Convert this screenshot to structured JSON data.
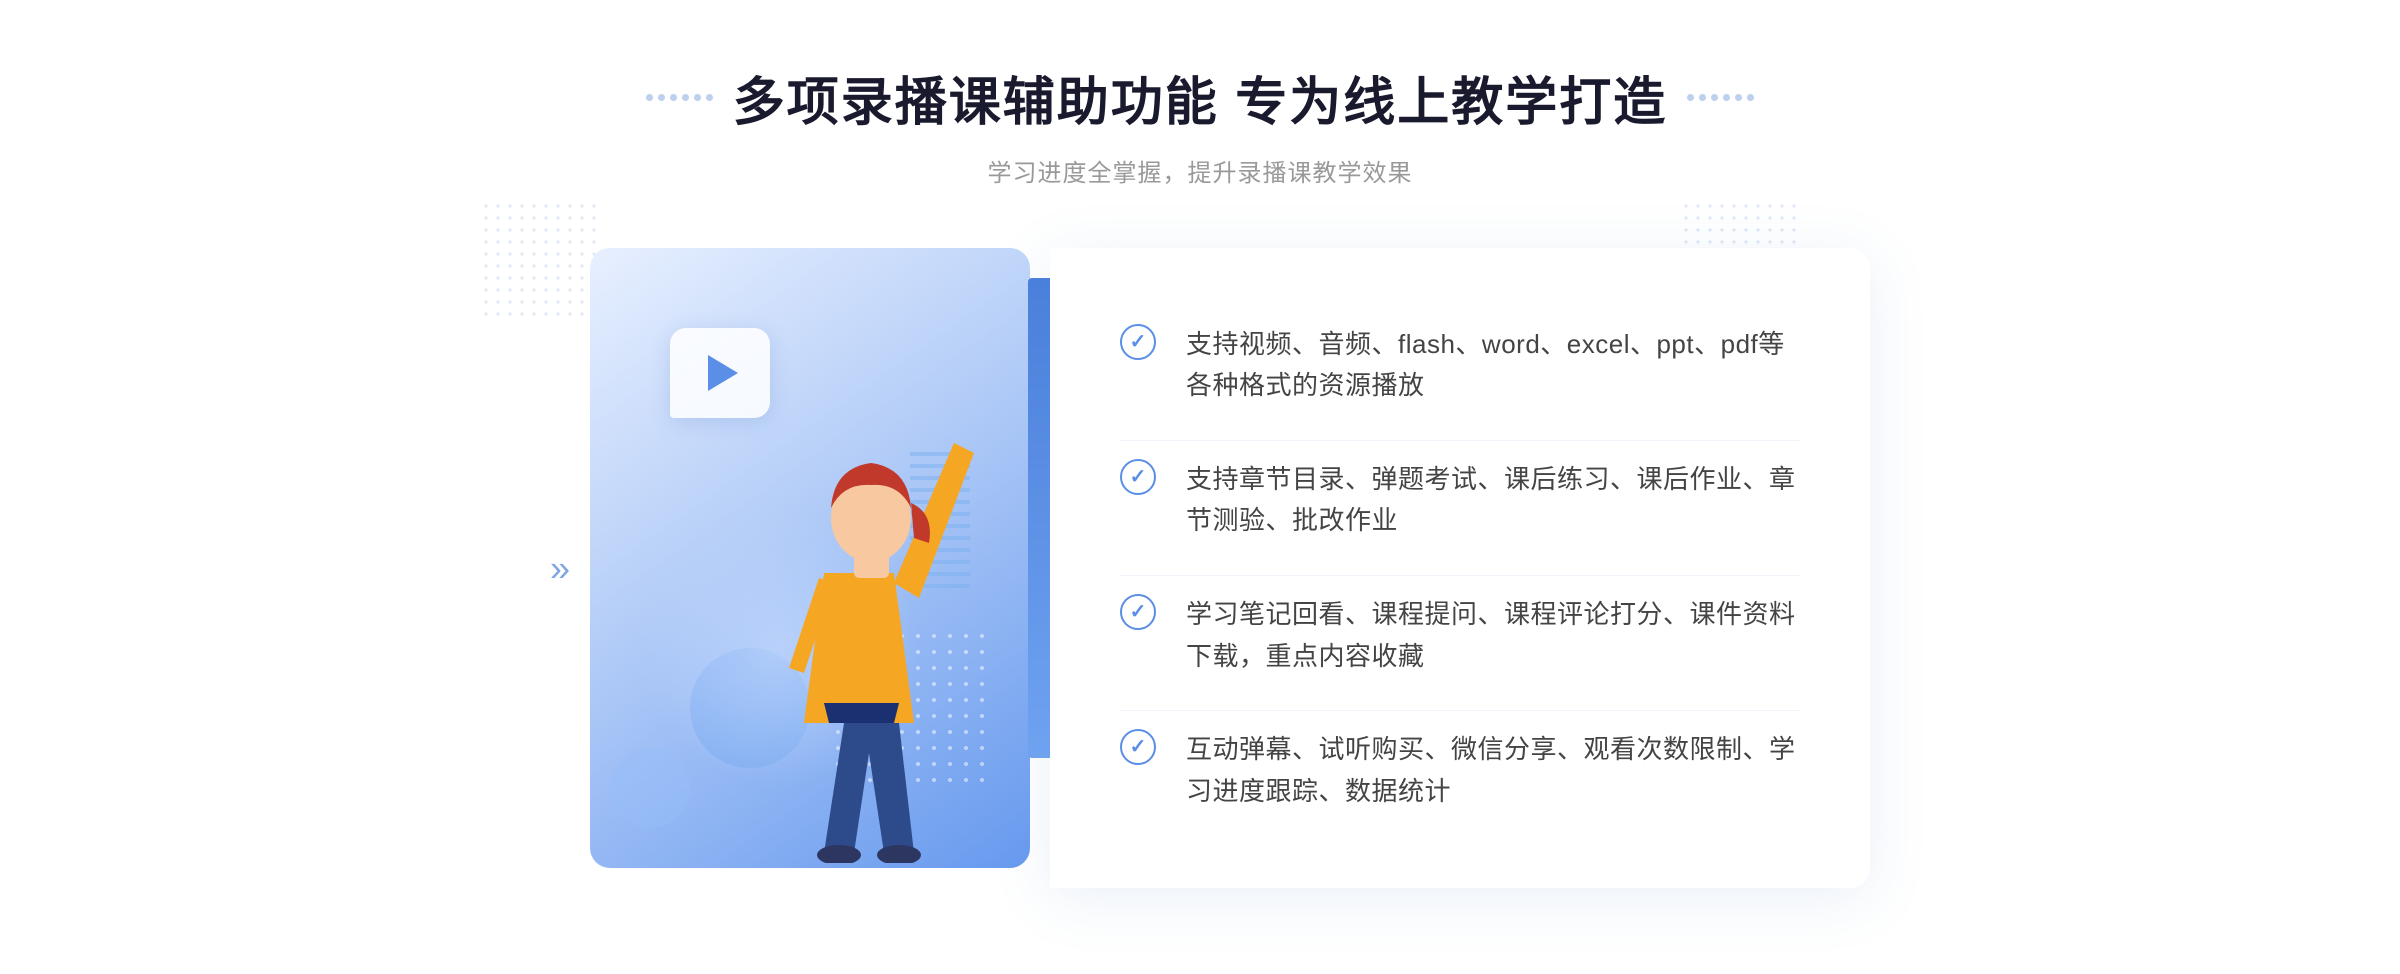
{
  "header": {
    "title": "多项录播课辅助功能 专为线上教学打造",
    "subtitle": "学习进度全掌握，提升录播课教学效果"
  },
  "features": [
    {
      "id": "feature-1",
      "text": "支持视频、音频、flash、word、excel、ppt、pdf等各种格式的资源播放"
    },
    {
      "id": "feature-2",
      "text": "支持章节目录、弹题考试、课后练习、课后作业、章节测验、批改作业"
    },
    {
      "id": "feature-3",
      "text": "学习笔记回看、课程提问、课程评论打分、课件资料下载，重点内容收藏"
    },
    {
      "id": "feature-4",
      "text": "互动弹幕、试听购买、微信分享、观看次数限制、学习进度跟踪、数据统计"
    }
  ],
  "decorations": {
    "chevrons": "»",
    "play_aria": "play-button"
  }
}
